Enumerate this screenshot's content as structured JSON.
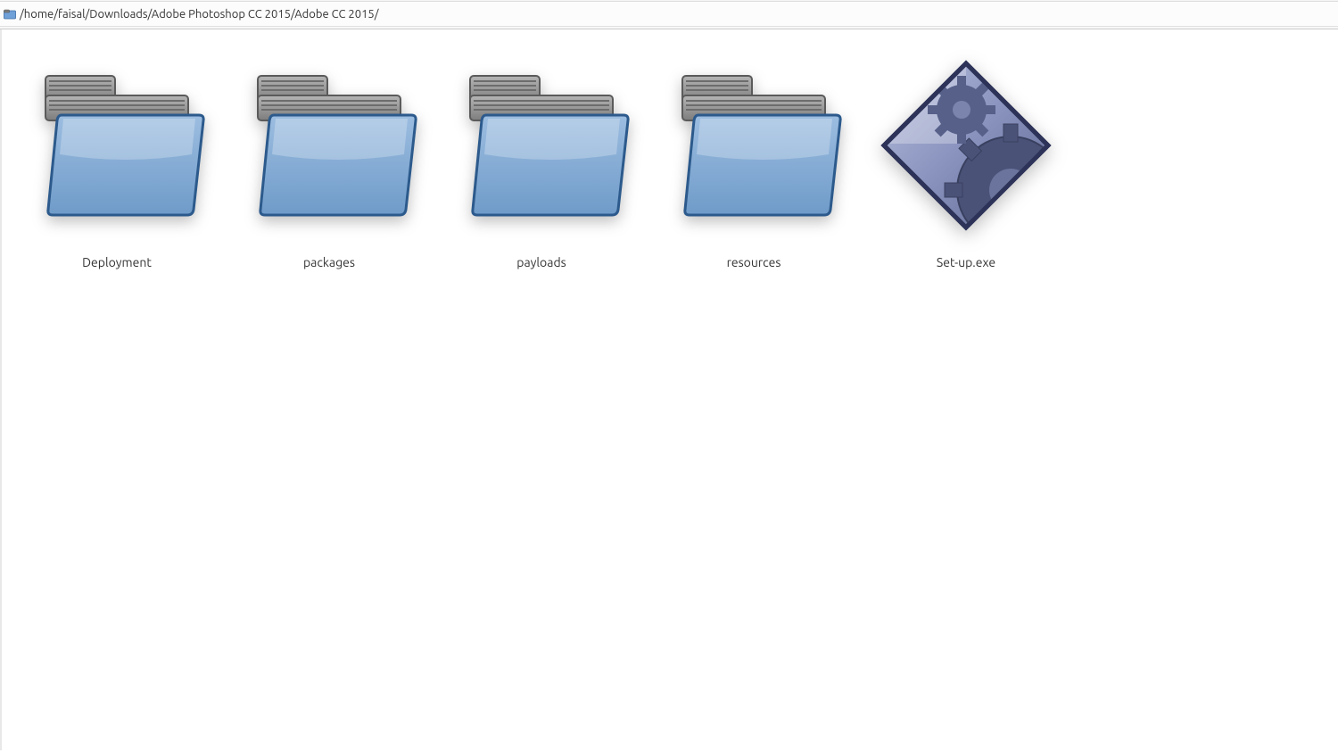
{
  "address_bar": {
    "path": "/home/faisal/Downloads/Adobe Photoshop CC 2015/Adobe CC 2015/"
  },
  "items": [
    {
      "name": "Deployment",
      "type": "folder"
    },
    {
      "name": "packages",
      "type": "folder"
    },
    {
      "name": "payloads",
      "type": "folder"
    },
    {
      "name": "resources",
      "type": "folder"
    },
    {
      "name": "Set-up.exe",
      "type": "executable"
    }
  ]
}
